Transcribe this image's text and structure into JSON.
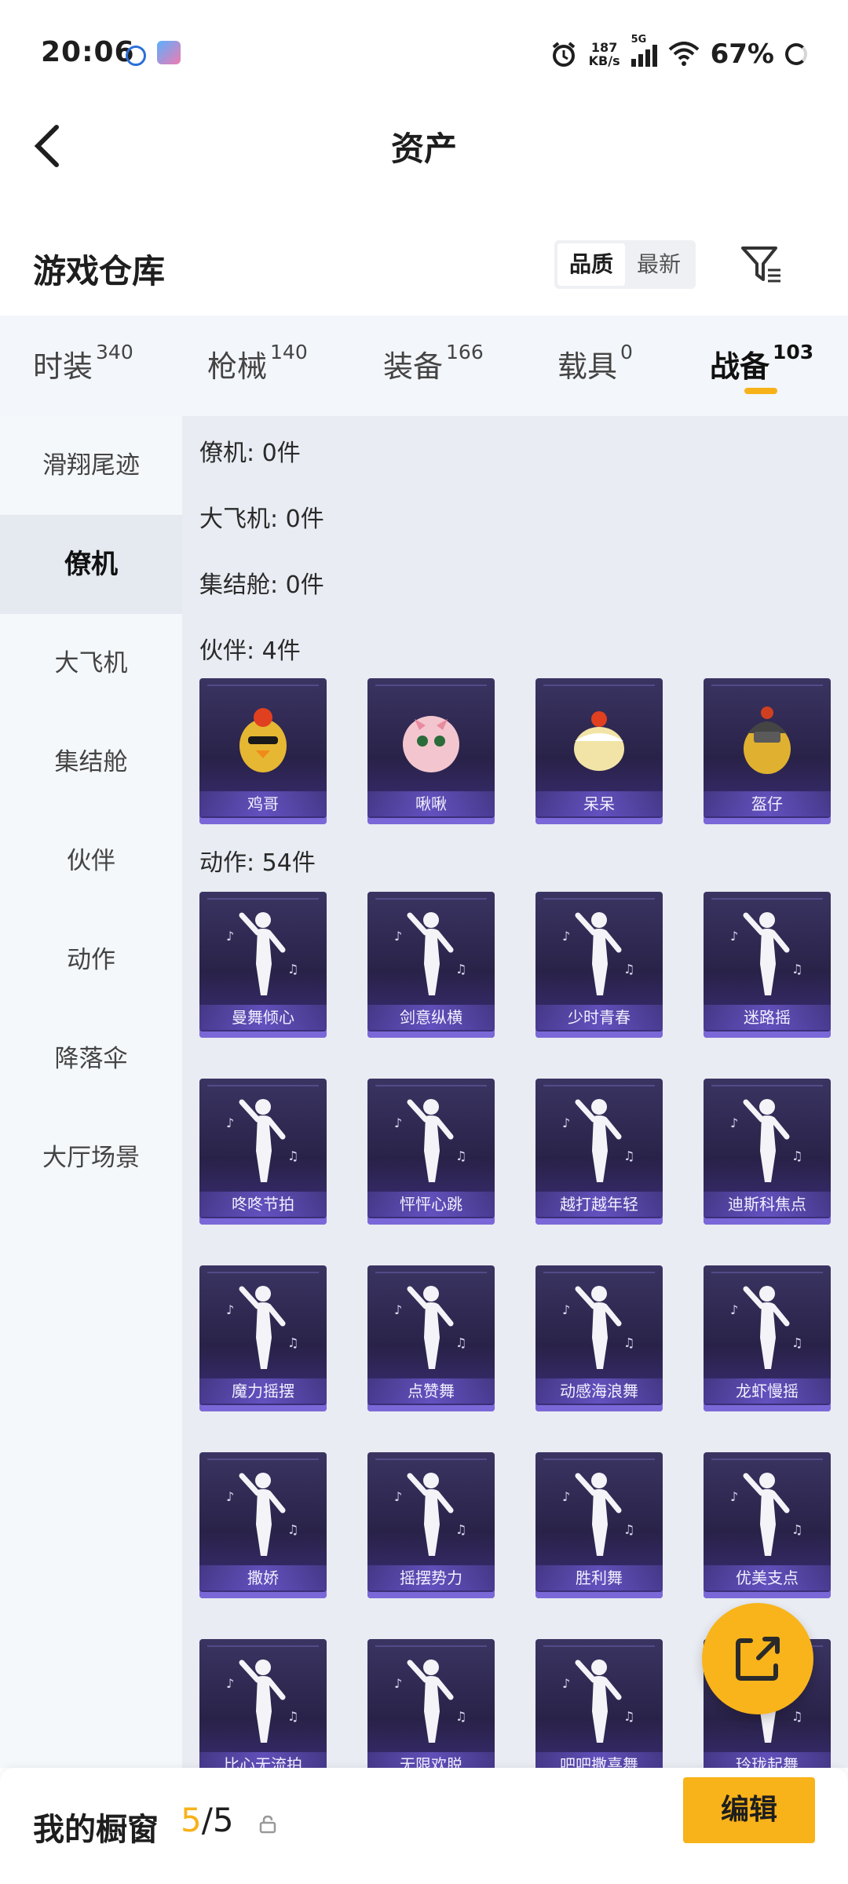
{
  "status_bar": {
    "time": "20:06",
    "net_speed": "187",
    "net_unit": "KB/s",
    "signal_type": "5G",
    "battery": "67%"
  },
  "header": {
    "title": "资产"
  },
  "warehouse": {
    "title": "游戏仓库",
    "sort_quality": "品质",
    "sort_newest": "最新"
  },
  "tabs": [
    {
      "label": "时装",
      "count": "340"
    },
    {
      "label": "枪械",
      "count": "140"
    },
    {
      "label": "装备",
      "count": "166"
    },
    {
      "label": "载具",
      "count": "0"
    },
    {
      "label": "战备",
      "count": "103"
    }
  ],
  "sidebar": {
    "items": [
      "滑翔尾迹",
      "僚机",
      "大飞机",
      "集结舱",
      "伙伴",
      "动作",
      "降落伞",
      "大厅场景"
    ]
  },
  "sections": {
    "wingman": "僚机: 0件",
    "big_plane": "大飞机: 0件",
    "rally_pod": "集结舱: 0件",
    "partners": "伙伴: 4件",
    "actions": "动作: 54件"
  },
  "partners": [
    "鸡哥",
    "啾啾",
    "呆呆",
    "盔仔"
  ],
  "actions": [
    "曼舞倾心",
    "剑意纵横",
    "少时青春",
    "迷路摇",
    "咚咚节拍",
    "怦怦心跳",
    "越打越年轻",
    "迪斯科焦点",
    "魔力摇摆",
    "点赞舞",
    "动感海浪舞",
    "龙虾慢摇",
    "撒娇",
    "摇摆势力",
    "胜利舞",
    "优美支点",
    "比心无流拍",
    "无限欢脱",
    "吧吧撒喜舞",
    "玲珑起舞"
  ],
  "bottom": {
    "label": "我的橱窗",
    "current": "5",
    "total": "/5",
    "edit": "编辑"
  },
  "colors": {
    "accent": "#f7b21a",
    "card_bg": "#2b2450",
    "card_edge": "#7b68d8"
  }
}
